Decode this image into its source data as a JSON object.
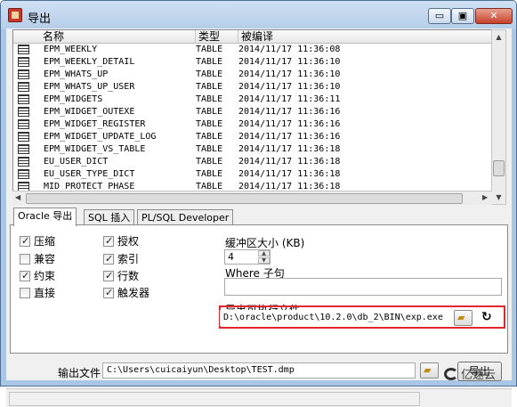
{
  "window": {
    "title": "导出",
    "min_glyph": "▭",
    "max_glyph": "▣",
    "close_glyph": "✕"
  },
  "list": {
    "columns": [
      "名称",
      "类型",
      "被编译"
    ],
    "rows": [
      {
        "name": "EPM_WEEKLY",
        "type": "TABLE",
        "date": "2014/11/17 11:36:08"
      },
      {
        "name": "EPM_WEEKLY_DETAIL",
        "type": "TABLE",
        "date": "2014/11/17 11:36:10"
      },
      {
        "name": "EPM_WHATS_UP",
        "type": "TABLE",
        "date": "2014/11/17 11:36:10"
      },
      {
        "name": "EPM_WHATS_UP_USER",
        "type": "TABLE",
        "date": "2014/11/17 11:36:10"
      },
      {
        "name": "EPM_WIDGETS",
        "type": "TABLE",
        "date": "2014/11/17 11:36:11"
      },
      {
        "name": "EPM_WIDGET_OUTEXE",
        "type": "TABLE",
        "date": "2014/11/17 11:36:16"
      },
      {
        "name": "EPM_WIDGET_REGISTER",
        "type": "TABLE",
        "date": "2014/11/17 11:36:16"
      },
      {
        "name": "EPM_WIDGET_UPDATE_LOG",
        "type": "TABLE",
        "date": "2014/11/17 11:36:16"
      },
      {
        "name": "EPM_WIDGET_VS_TABLE",
        "type": "TABLE",
        "date": "2014/11/17 11:36:18"
      },
      {
        "name": "EU_USER_DICT",
        "type": "TABLE",
        "date": "2014/11/17 11:36:18"
      },
      {
        "name": "EU_USER_TYPE_DICT",
        "type": "TABLE",
        "date": "2014/11/17 11:36:18"
      },
      {
        "name": "MID_PROTECT_PHASE",
        "type": "TABLE",
        "date": "2014/11/17 11:36:18"
      }
    ]
  },
  "tabs": [
    "Oracle 导出",
    "SQL 插入",
    "PL/SQL Developer"
  ],
  "options": {
    "compress": "压缩",
    "compatible": "兼容",
    "constraints": "约束",
    "direct": "直接",
    "grants": "授权",
    "indexes": "索引",
    "rows": "行数",
    "triggers": "触发器"
  },
  "checked": {
    "compress": true,
    "compatible": false,
    "constraints": true,
    "direct": false,
    "grants": true,
    "indexes": true,
    "rows": true,
    "triggers": true
  },
  "buffer": {
    "label": "缓冲区大小 (KB)",
    "value": "4"
  },
  "where": {
    "label": "Where 子句",
    "value": ""
  },
  "exe": {
    "label": "导出可执行文件",
    "path": "D:\\oracle\\product\\10.2.0\\db_2\\BIN\\exp.exe"
  },
  "output": {
    "label": "输出文件",
    "path": "C:\\Users\\cuicaiyun\\Desktop\\TEST.dmp"
  },
  "export_button": "导出",
  "watermark": "亿速云",
  "accent_color": "#e2262a"
}
